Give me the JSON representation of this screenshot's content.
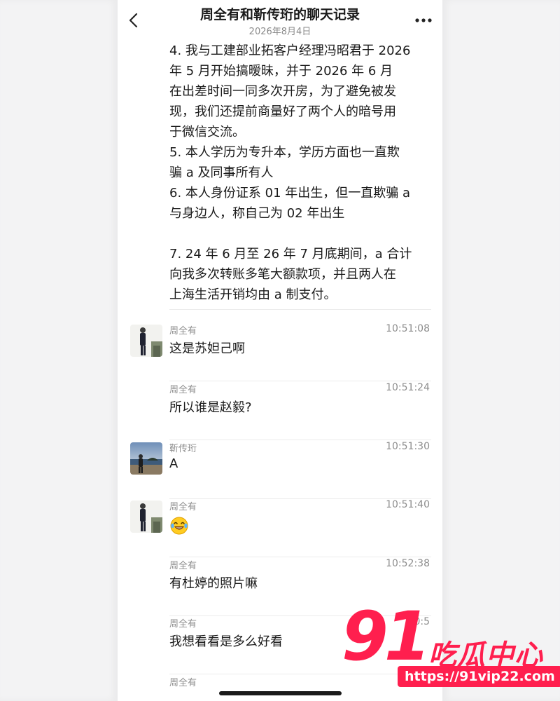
{
  "header": {
    "title": "周全有和靳传珩的聊天记录",
    "date": "2026年8月4日"
  },
  "long_message": "4. 我与工建部业拓客户经理冯昭君于 2026\n年 5 月开始搞暧昧，并于 2026 年 6 月\n在出差时间一同多次开房，为了避免被发\n现，我们还提前商量好了两个人的暗号用\n于微信交流。\n5. 本人学历为专升本，学历方面也一直欺\n骗 a 及同事所有人\n6. 本人身份证系 01 年出生，但一直欺骗 a\n与身边人，称自己为 02 年出生\n\n7. 24 年 6 月至 26 年 7 月底期间，a 合计\n向我多次转账多笔大额款项，并且两人在\n上海生活开销均由 a 制支付。",
  "messages": [
    {
      "sender": "周全有",
      "time": "10:51:08",
      "text": "这是苏妲己啊"
    },
    {
      "sender": "周全有",
      "time": "10:51:24",
      "text": "所以谁是赵毅?"
    },
    {
      "sender": "靳传珩",
      "time": "10:51:30",
      "text": "A"
    },
    {
      "sender": "周全有",
      "time": "10:51:40",
      "text": ""
    },
    {
      "sender": "周全有",
      "time": "10:52:38",
      "text": "有杜婷的照片嘛"
    },
    {
      "sender": "周全有",
      "time": "10:5",
      "text": "我想看看是多么好看"
    },
    {
      "sender": "周全有",
      "time": "",
      "text": ""
    }
  ],
  "watermark": {
    "number": "91",
    "name": "吃瓜中心",
    "url": "https://91vip22.com"
  },
  "icons": {
    "back": "chevron-left-icon",
    "more": "more-dots-icon",
    "emoji": "laughing-tears-emoji-icon"
  },
  "colors": {
    "watermark": "#ff1f4e",
    "text": "#1a1a1a",
    "muted": "#8c8c8c"
  }
}
